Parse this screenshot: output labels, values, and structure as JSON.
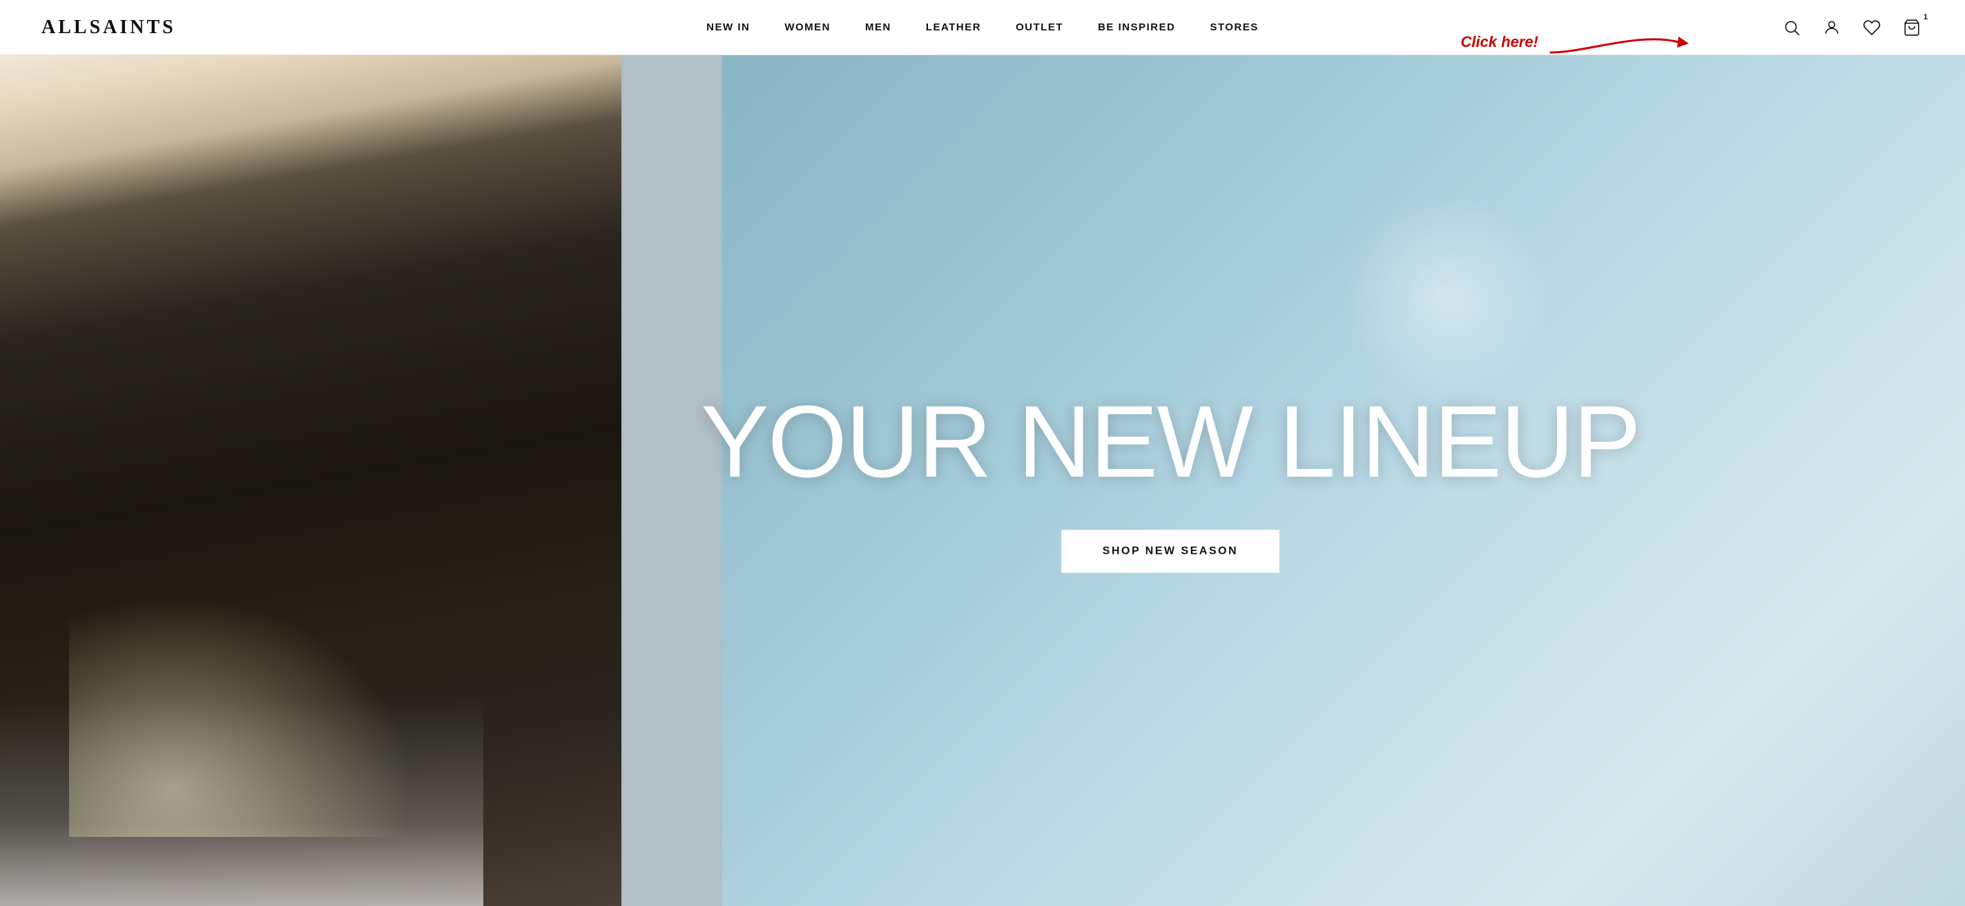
{
  "header": {
    "logo": "ALLSAINTS",
    "nav": {
      "items": [
        {
          "id": "new-in",
          "label": "NEW IN"
        },
        {
          "id": "women",
          "label": "WOMEN"
        },
        {
          "id": "men",
          "label": "MEN"
        },
        {
          "id": "leather",
          "label": "LEATHER"
        },
        {
          "id": "outlet",
          "label": "OUTLET"
        },
        {
          "id": "be-inspired",
          "label": "BE INSPIRED"
        },
        {
          "id": "stores",
          "label": "STORES"
        }
      ]
    },
    "icons": {
      "search_label": "search",
      "account_label": "account",
      "wishlist_label": "wishlist",
      "cart_label": "cart",
      "cart_count": "1"
    },
    "annotation": {
      "click_here_text": "Click here!",
      "arrow_color": "#cc0000"
    }
  },
  "hero": {
    "title": "YOUR NEW LINEUP",
    "cta_label": "SHOP NEW SEASON",
    "bg_description": "Fashion model in leather jacket with grey/teal background"
  }
}
